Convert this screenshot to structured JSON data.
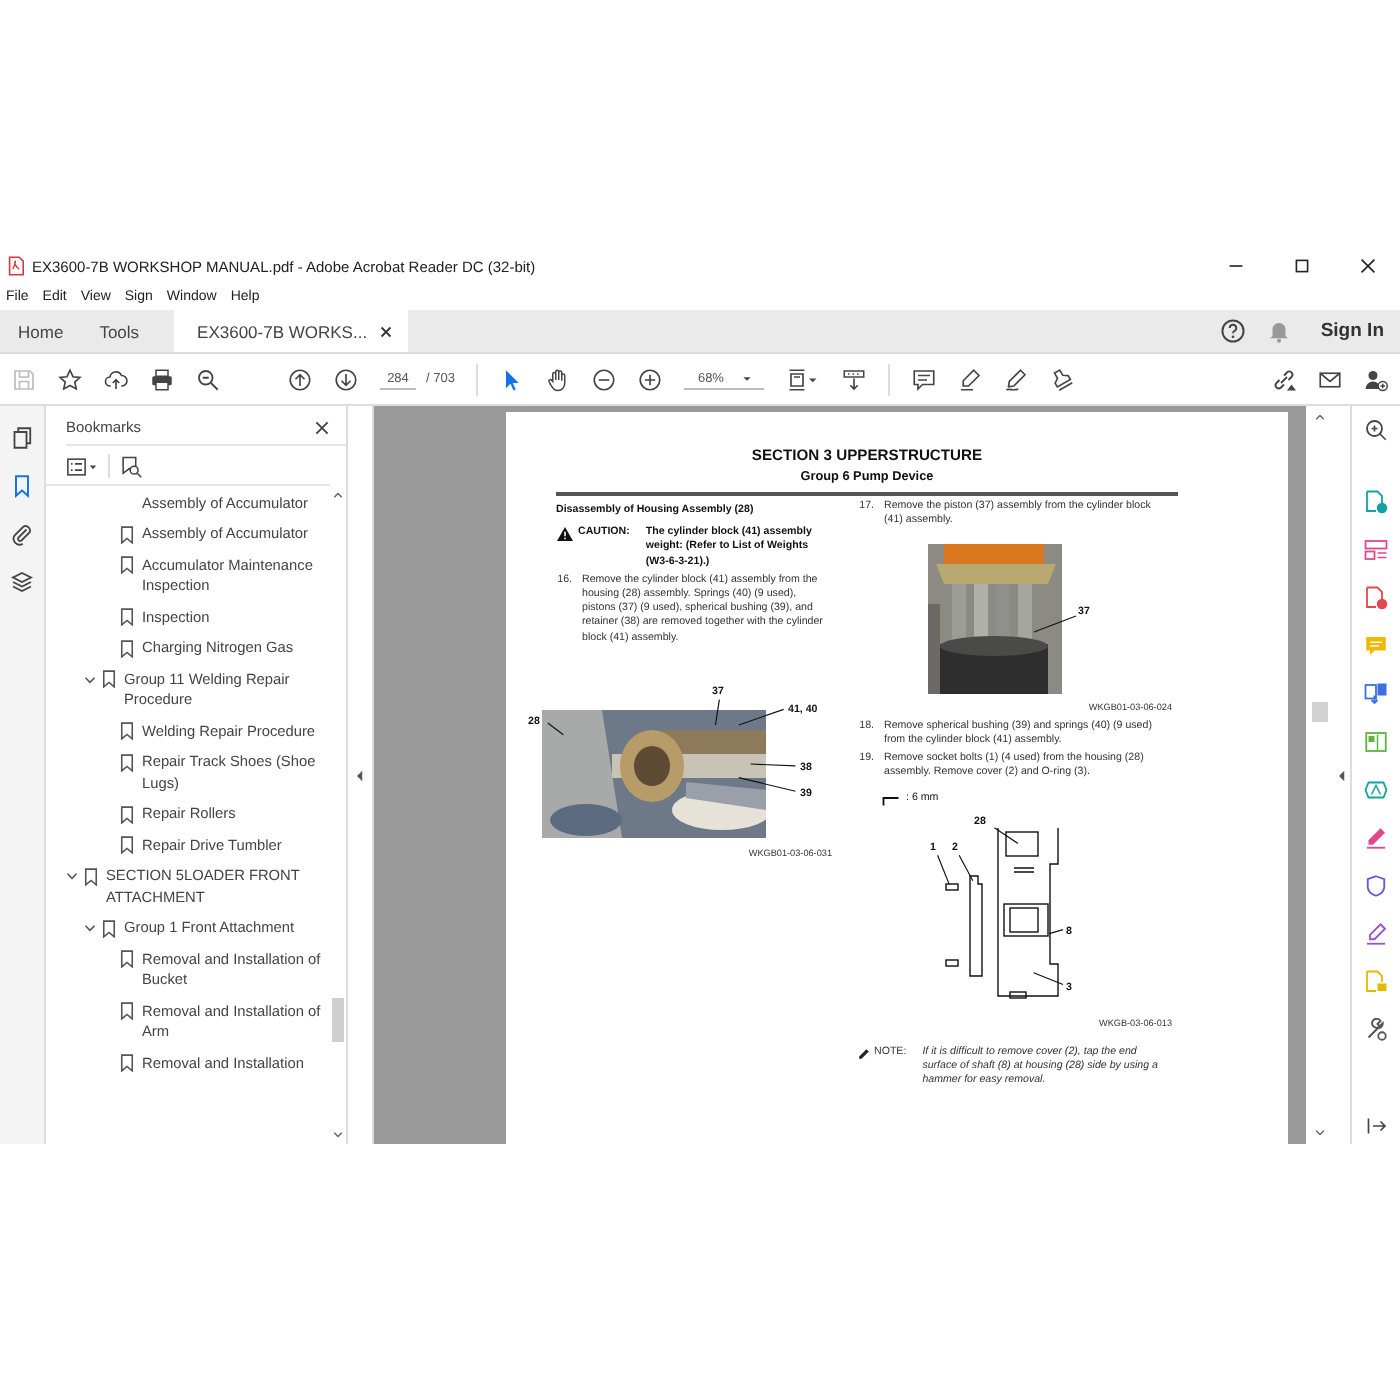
{
  "window": {
    "title": "EX3600-7B WORKSHOP MANUAL.pdf - Adobe Acrobat Reader DC (32-bit)"
  },
  "menu": [
    "File",
    "Edit",
    "View",
    "Sign",
    "Window",
    "Help"
  ],
  "tabs": [
    {
      "label": "Home",
      "selected": false,
      "closable": false
    },
    {
      "label": "Tools",
      "selected": false,
      "closable": false
    },
    {
      "label": "EX3600-7B WORKS...",
      "selected": true,
      "closable": true
    }
  ],
  "account": {
    "sign_in": "Sign In"
  },
  "toolbar": {
    "save_disabled": true,
    "select_tool_on": true,
    "page": "284",
    "page_count": "/ 703",
    "zoom": "68%"
  },
  "left_rail": [
    {
      "kind": "pages",
      "selected": false
    },
    {
      "kind": "bookmarks",
      "selected": true
    },
    {
      "kind": "attachments",
      "selected": false
    },
    {
      "kind": "layers",
      "selected": false
    }
  ],
  "bookmarks": {
    "title": "Bookmarks",
    "tree": [
      {
        "children": [
          {
            "children": [
              {
                "label": "Assembly of Accumulator",
                "cut_top": true
              },
              {
                "label": "Assembly of Accumulator",
                "cut_top": false
              },
              {
                "label": "Accumulator Maintenance Inspection",
                "cut_top": false
              },
              {
                "label": "Inspection",
                "cut_top": false
              },
              {
                "label": "Charging Nitrogen Gas",
                "cut_top": false
              }
            ]
          },
          {
            "label": "Group 11 Welding Repair Procedure",
            "expanded": true,
            "children": [
              {
                "label": "Welding Repair Procedure",
                "cut_top": false
              },
              {
                "label": "Repair Track Shoes (Shoe Lugs)",
                "cut_top": false
              },
              {
                "label": "Repair Rollers",
                "cut_top": false
              },
              {
                "label": "Repair Drive Tumbler",
                "cut_top": false
              }
            ]
          }
        ]
      },
      {
        "label": "SECTION 5LOADER FRONT ATTACHMENT",
        "expanded": true,
        "children": [
          {
            "label": "Group 1 Front Attachment",
            "expanded": true,
            "children": [
              {
                "label": "Removal and Installation of Bucket",
                "cut_top": false
              },
              {
                "label": "Removal and Installation of Arm",
                "cut_top": false
              },
              {
                "label": "Removal and Installation",
                "cut_top": false
              }
            ]
          }
        ]
      }
    ]
  },
  "document": {
    "section_title": "SECTION 3 UPPERSTRUCTURE",
    "group_title": "Group 6 Pump Device",
    "heading": "Disassembly of Housing Assembly (28)",
    "caution_label": "CAUTION:",
    "caution_text": "The cylinder block (41) assembly weight: (Refer to List of Weights (W3-6-3-21).)",
    "step_16": {
      "number": "16.",
      "text": "Remove the cylinder block (41) assembly from the housing (28) assembly. Springs (40) (9 used), pistons (37) (9 used), spherical bushing (39), and retainer (38) are removed together with the cylinder block (41) assembly."
    },
    "figure_1": {
      "callouts": [
        "37",
        "41, 40",
        "28",
        "38",
        "39"
      ],
      "caption": "WKGB01-03-06-031"
    },
    "step_17": {
      "number": "17.",
      "text": "Remove the piston (37) assembly from the cylinder block (41) assembly."
    },
    "figure_2": {
      "callouts": [
        "37"
      ],
      "caption": "WKGB01-03-06-024"
    },
    "step_18": {
      "number": "18.",
      "text": "Remove spherical bushing (39) and springs (40) (9 used) from the cylinder block (41) assembly."
    },
    "step_19": {
      "number": "19.",
      "text": "Remove socket bolts (1) (4 used) from the housing (28) assembly. Remove cover (2) and O-ring (3)."
    },
    "tool_size": ": 6 mm",
    "figure_3": {
      "callouts": [
        "28",
        "1",
        "2",
        "8",
        "3"
      ],
      "caption": "WKGB-03-06-013"
    },
    "note_label": "NOTE:",
    "note_text": "If it is difficult to remove cover (2), tap the end surface of shaft (8) at housing (28) side by using a hammer for easy removal."
  }
}
